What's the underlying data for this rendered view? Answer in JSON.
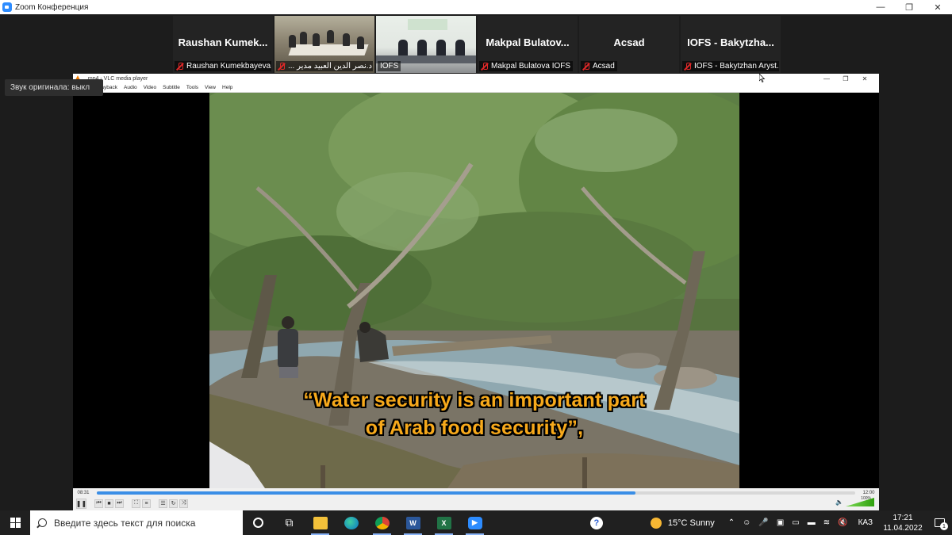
{
  "window": {
    "title": "Zoom Конференция",
    "controls": {
      "minimize": "—",
      "maximize": "❐",
      "close": "✕"
    }
  },
  "gallery": [
    {
      "display_name": "Raushan  Kumek...",
      "label": "Raushan Kumekbayeva",
      "muted": true,
      "type": "name"
    },
    {
      "display_name": "",
      "label": "... د.نصر الدين العبيد مدير",
      "muted": true,
      "type": "video",
      "selected": true
    },
    {
      "display_name": "",
      "label": "IOFS",
      "muted": false,
      "type": "video"
    },
    {
      "display_name": "Makpal  Bulatov...",
      "label": "Makpal Bulatova IOFS",
      "muted": true,
      "type": "name"
    },
    {
      "display_name": "Acsad",
      "label": "Acsad",
      "muted": true,
      "type": "name"
    },
    {
      "display_name": "IOFS  -  Bakytzha...",
      "label": "IOFS - Bakytzhan Aryst...",
      "muted": true,
      "type": "name"
    }
  ],
  "language_tooltip": "Звук оригинала: выкл",
  "vlc": {
    "title": "...mp4 - VLC media player",
    "menus": [
      "...ayback",
      "Audio",
      "Video",
      "Subtitle",
      "Tools",
      "View",
      "Help"
    ],
    "subtitle_line1": "“Water security is an important part",
    "subtitle_line2": "of Arab food security”,",
    "time_elapsed": "08:31",
    "time_total": "12:00",
    "progress": 0.71,
    "volume_label": "100%"
  },
  "taskbar": {
    "search_placeholder": "Введите здесь текст для поиска",
    "weather": "15°C  Sunny",
    "language": "КАЗ",
    "time": "17:21",
    "date": "11.04.2022",
    "notification_count": "1",
    "word_letter": "W",
    "excel_letter": "X",
    "help_glyph": "?"
  }
}
